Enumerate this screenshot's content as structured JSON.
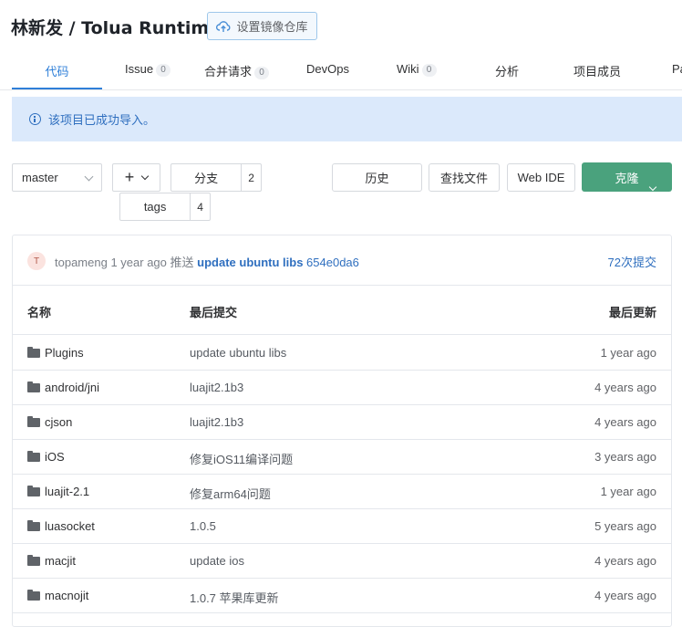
{
  "header": {
    "repo_title": "林新发 / Tolua Runtime",
    "mirror_button": "设置镜像仓库"
  },
  "tabs": [
    {
      "label": "代码",
      "count": null,
      "active": true
    },
    {
      "label": "Issue",
      "count": "0"
    },
    {
      "label": "合并请求",
      "count": "0"
    },
    {
      "label": "DevOps",
      "count": null
    },
    {
      "label": "Wiki",
      "count": "0"
    },
    {
      "label": "分析",
      "count": null
    },
    {
      "label": "项目成员",
      "count": null
    },
    {
      "label": "Pa",
      "count": null
    }
  ],
  "alert": {
    "text": "该项目已成功导入。"
  },
  "toolbar": {
    "branch": "master",
    "plus": "+",
    "branches_label": "分支",
    "branches_count": "2",
    "tags_label": "tags",
    "tags_count": "4",
    "history": "历史",
    "find_file": "查找文件",
    "web_ide": "Web IDE",
    "clone": "克隆"
  },
  "commit": {
    "avatar": "T",
    "author": "topameng",
    "time": "1 year ago",
    "action": "推送",
    "message": "update ubuntu libs",
    "hash": "654e0da6",
    "count": "72次提交"
  },
  "table": {
    "headers": {
      "name": "名称",
      "last_commit": "最后提交",
      "last_update": "最后更新"
    },
    "rows": [
      {
        "name": "Plugins",
        "last_commit": "update ubuntu libs",
        "updated": "1 year ago"
      },
      {
        "name": "android/jni",
        "last_commit": "luajit2.1b3",
        "updated": "4 years ago"
      },
      {
        "name": "cjson",
        "last_commit": "luajit2.1b3",
        "updated": "4 years ago"
      },
      {
        "name": "iOS",
        "last_commit": "修复iOS11编译问题",
        "updated": "3 years ago"
      },
      {
        "name": "luajit-2.1",
        "last_commit": "修复arm64问题",
        "updated": "1 year ago"
      },
      {
        "name": "luasocket",
        "last_commit": "1.0.5",
        "updated": "5 years ago"
      },
      {
        "name": "macjit",
        "last_commit": "update ios",
        "updated": "4 years ago"
      },
      {
        "name": "macnojit",
        "last_commit": "1.0.7 苹果库更新",
        "updated": "4 years ago"
      }
    ]
  },
  "colors": {
    "accent": "#2f7fd8",
    "clone_green": "#4aa27d",
    "alert_bg": "#dbe9fb"
  }
}
